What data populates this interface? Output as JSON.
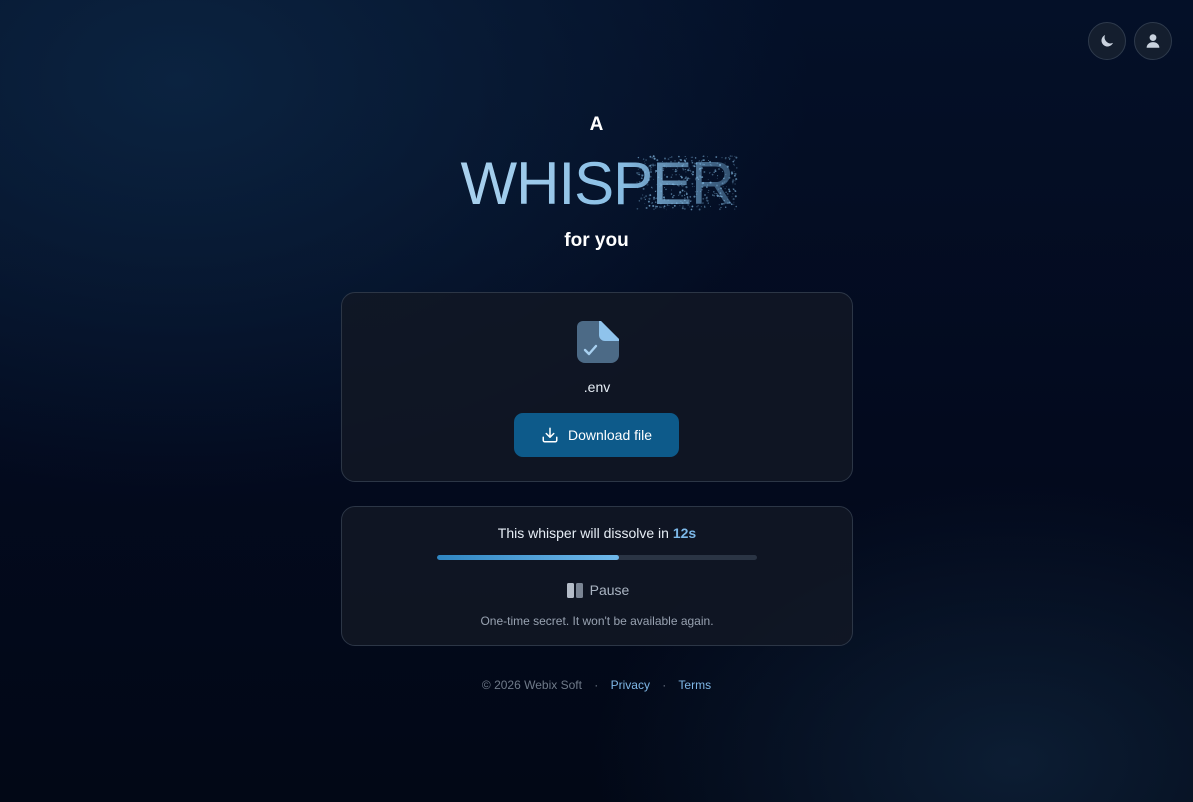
{
  "header": {
    "theme_toggle_icon": "moon-icon",
    "account_icon": "user-icon"
  },
  "hero": {
    "prefix": "A",
    "title": "WHISPER",
    "suffix": "for you"
  },
  "file": {
    "icon": "file-check-icon",
    "name": ".env",
    "download_label": "Download file",
    "download_icon": "download-icon"
  },
  "timer": {
    "message": "This whisper will dissolve in",
    "remaining": "12s",
    "progress_fraction": 0.57,
    "pause_label": "Pause",
    "pause_icon": "pause-icon",
    "note": "One-time secret. It won't be available again."
  },
  "footer": {
    "copyright": "© 2026 Webix Soft",
    "separator": "·",
    "privacy_label": "Privacy",
    "terms_label": "Terms"
  },
  "colors": {
    "accent": "#0d5a8a",
    "accent_light": "#7cb8e8",
    "background": "#030a1e"
  }
}
